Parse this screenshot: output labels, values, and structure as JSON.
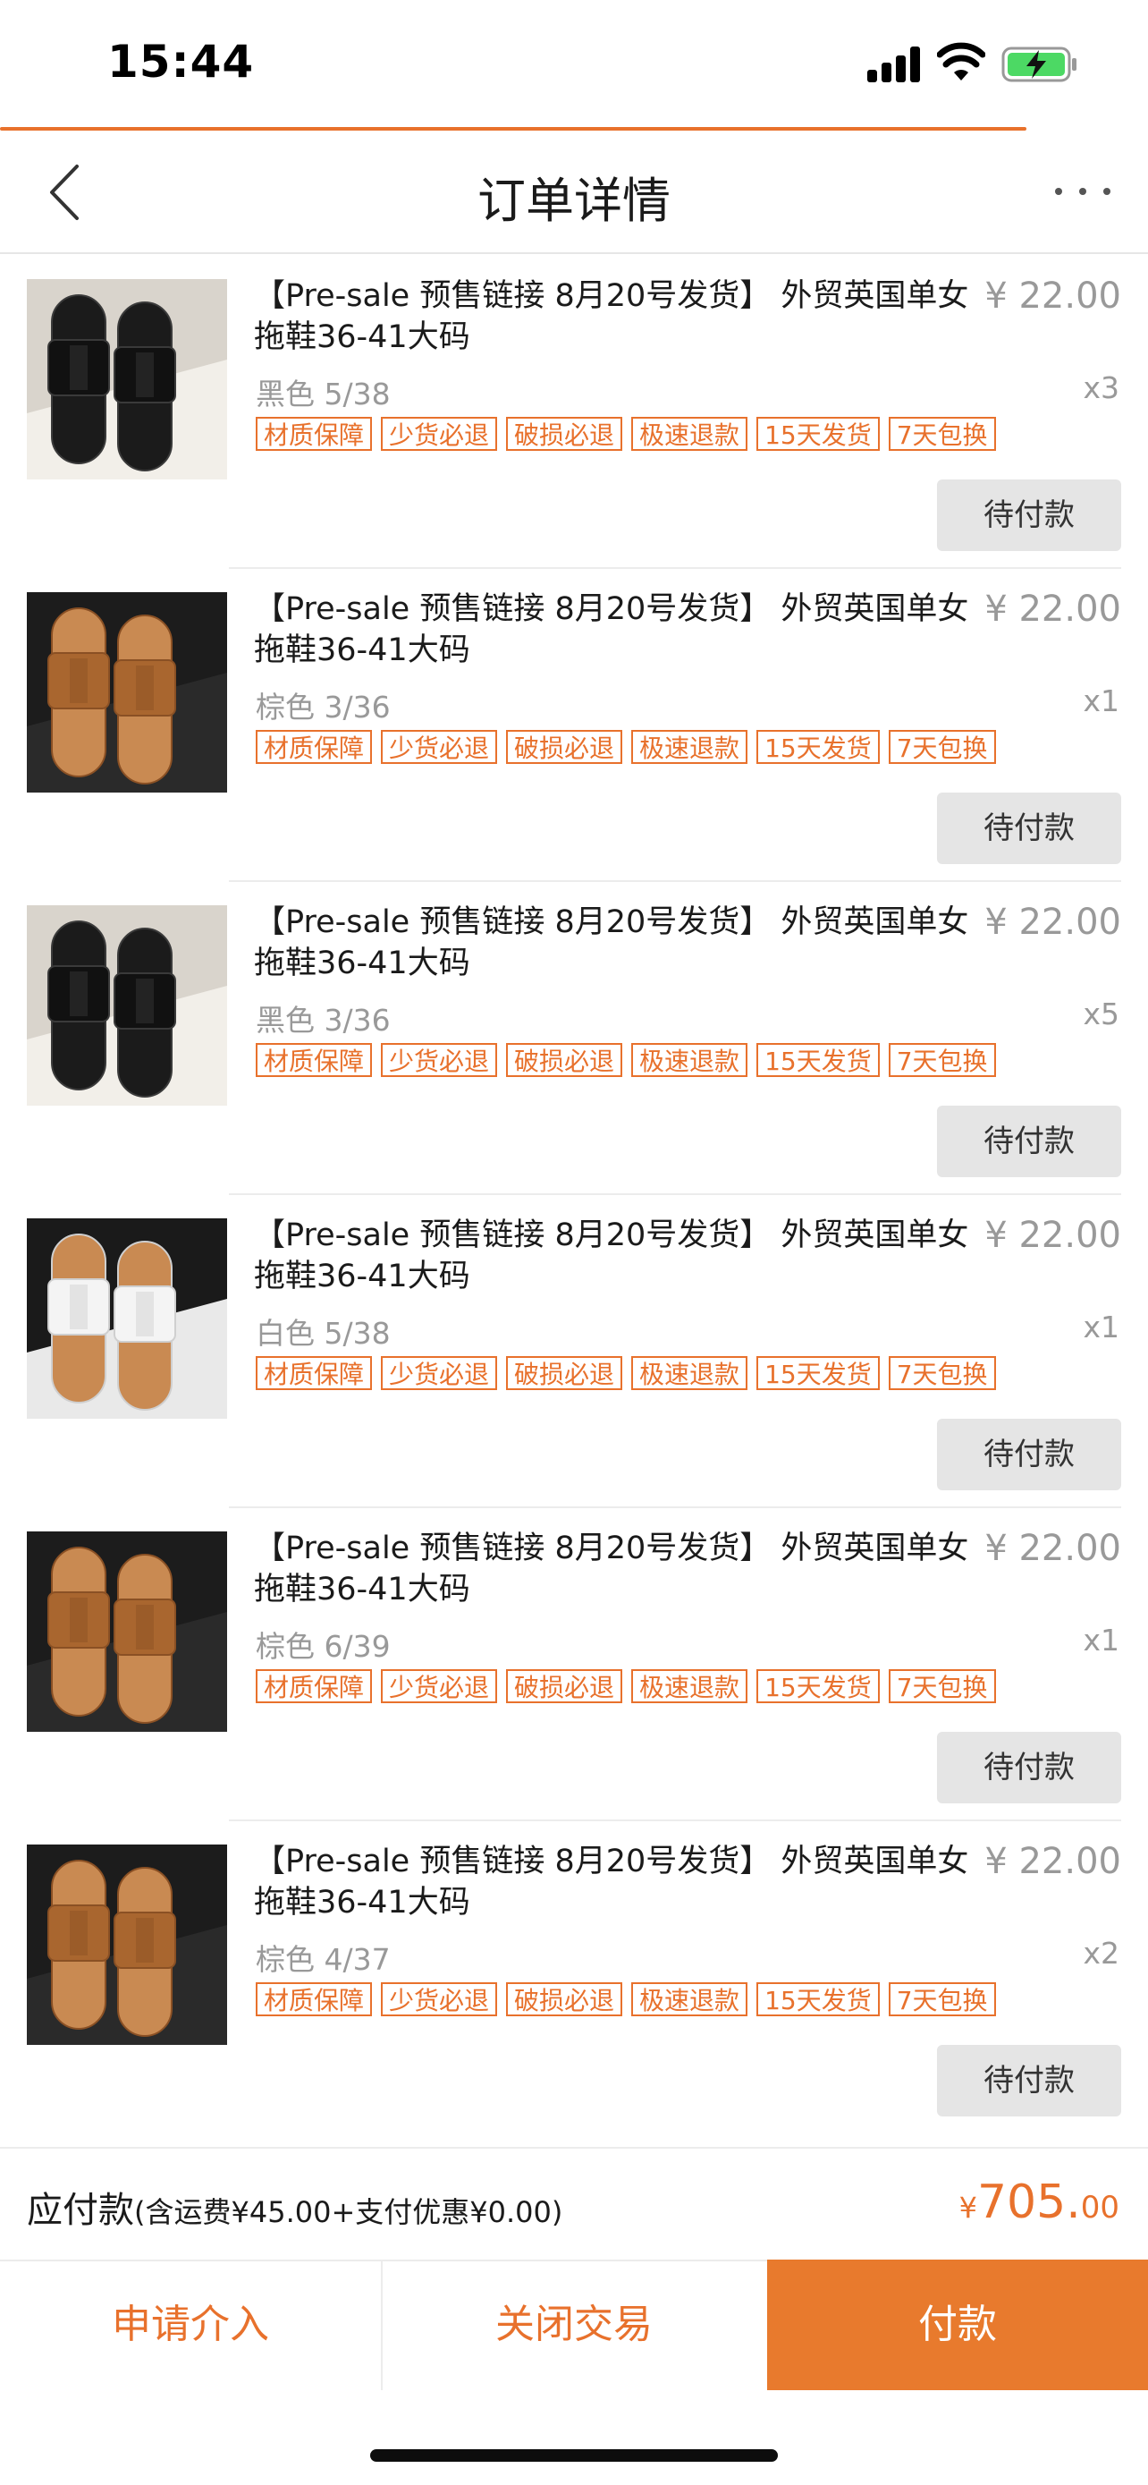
{
  "status_bar": {
    "time": "15:44"
  },
  "nav": {
    "title": "订单详情"
  },
  "items": [
    {
      "title": "【Pre-sale 预售链接 8月20号发货】 外贸英国单女拖鞋36-41大码",
      "price": "¥ 22.00",
      "spec": "黑色 5/38",
      "qty": "x3",
      "image": "black-slide-sandals-photo",
      "action": "待付款"
    },
    {
      "title": "【Pre-sale 预售链接 8月20号发货】 外贸英国单女拖鞋36-41大码",
      "price": "¥ 22.00",
      "spec": "棕色 3/36",
      "qty": "x1",
      "image": "brown-slide-sandals-photo",
      "action": "待付款"
    },
    {
      "title": "【Pre-sale 预售链接 8月20号发货】 外贸英国单女拖鞋36-41大码",
      "price": "¥ 22.00",
      "spec": "黑色 3/36",
      "qty": "x5",
      "image": "black-slide-sandals-photo",
      "action": "待付款"
    },
    {
      "title": "【Pre-sale 预售链接 8月20号发货】 外贸英国单女拖鞋36-41大码",
      "price": "¥ 22.00",
      "spec": "白色 5/38",
      "qty": "x1",
      "image": "white-slide-sandals-photo",
      "action": "待付款"
    },
    {
      "title": "【Pre-sale 预售链接 8月20号发货】 外贸英国单女拖鞋36-41大码",
      "price": "¥ 22.00",
      "spec": "棕色 6/39",
      "qty": "x1",
      "image": "brown-slide-sandals-photo",
      "action": "待付款"
    },
    {
      "title": "【Pre-sale 预售链接 8月20号发货】 外贸英国单女拖鞋36-41大码",
      "price": "¥ 22.00",
      "spec": "棕色 4/37",
      "qty": "x2",
      "image": "brown-slide-sandals-photo",
      "action": "待付款"
    }
  ],
  "tags": [
    "材质保障",
    "少货必退",
    "破损必退",
    "极速退款",
    "15天发货",
    "7天包换"
  ],
  "summary": {
    "label": "应付款",
    "note": "(含运费¥45.00+支付优惠¥0.00)",
    "currency": "¥",
    "amount_int": "705.",
    "amount_dec": "00"
  },
  "bottom_bar": {
    "apply": "申请介入",
    "close": "关闭交易",
    "pay": "付款"
  },
  "colors": {
    "accent": "#e8712c",
    "pay_bg": "#e87a2d",
    "muted": "#999999"
  }
}
